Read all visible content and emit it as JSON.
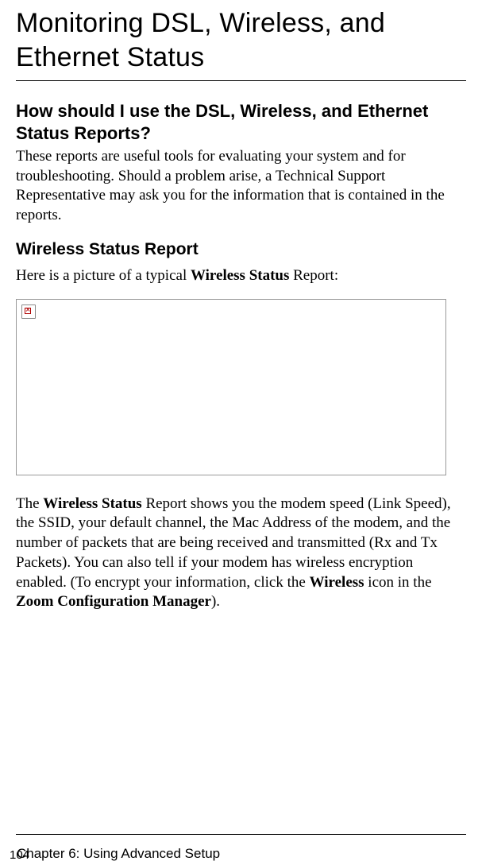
{
  "title": "Monitoring DSL, Wireless, and Ethernet Status",
  "section1": {
    "heading": "How should I use the DSL, Wireless, and Ethernet Status Reports?",
    "body": "These reports are useful tools for evaluating your system and for troubleshooting. Should a problem arise, a Technical Support Representative may ask you for the information that is contained in the reports."
  },
  "section2": {
    "heading": "Wireless Status Report",
    "intro_pre": "Here is a picture of a typical ",
    "intro_bold": "Wireless Status",
    "intro_post": " Report:",
    "desc_p1": "The ",
    "desc_b1": "Wireless Status",
    "desc_p2": " Report shows you the modem speed (Link Speed), the SSID, your default channel, the Mac Address of the modem, and the number of packets that are being received and transmitted (Rx and Tx Packets). You can also tell if your modem has wireless encryption enabled. (To encrypt your information, click the ",
    "desc_b2": "Wireless",
    "desc_p3": " icon in the ",
    "desc_b3": "Zoom Configuration Manager",
    "desc_p4": ")."
  },
  "footer": {
    "page_number": "104",
    "chapter": "Chapter 6: Using Advanced Setup"
  }
}
